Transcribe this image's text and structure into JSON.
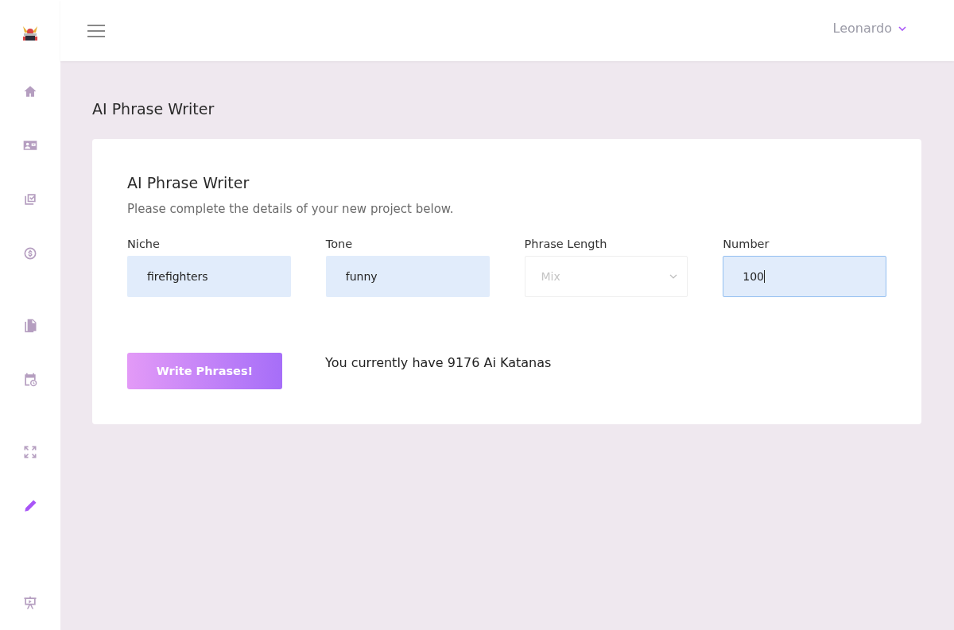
{
  "sidebar": {
    "sections": [
      {
        "items": [
          {
            "kind": "home",
            "selected": false
          },
          {
            "kind": "id-card",
            "selected": false
          },
          {
            "kind": "checklist",
            "selected": false
          },
          {
            "kind": "dollar",
            "selected": false
          }
        ]
      },
      {
        "items": [
          {
            "kind": "document",
            "selected": false
          },
          {
            "kind": "calendar",
            "selected": false
          }
        ]
      },
      {
        "items": [
          {
            "kind": "expand",
            "selected": false
          },
          {
            "kind": "pen",
            "selected": true
          }
        ]
      },
      {
        "items": [
          {
            "kind": "presentation",
            "selected": false
          }
        ]
      }
    ]
  },
  "header": {
    "user": "Leonardo"
  },
  "page_title": "AI Phrase Writer",
  "card": {
    "title": "AI Phrase Writer",
    "subtitle": "Please complete the details of your new project below.",
    "fields": [
      {
        "kind": "text",
        "label": "Niche",
        "value": "firefighters",
        "focused": false
      },
      {
        "kind": "text",
        "label": "Tone",
        "value": "funny",
        "focused": false
      },
      {
        "kind": "select",
        "label": "Phrase Length",
        "placeholder": "Mix",
        "focused": false
      },
      {
        "kind": "text",
        "label": "Number",
        "value": "100",
        "focused": true
      }
    ],
    "button": "Write Phrases!",
    "credits": "You currently have 9176 Ai Katanas"
  }
}
